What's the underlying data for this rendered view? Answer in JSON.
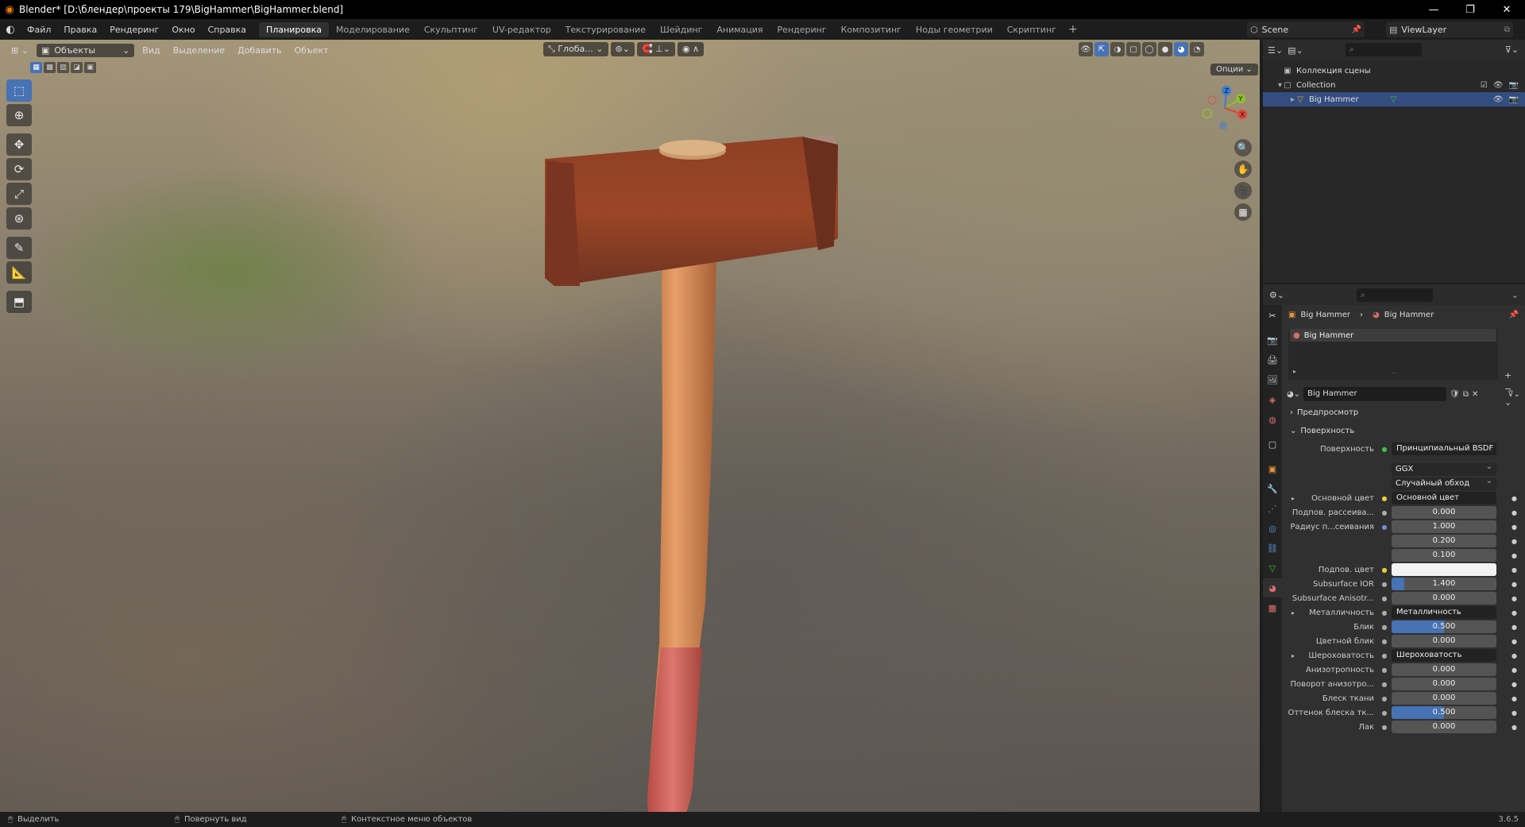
{
  "window": {
    "title": "Blender* [D:\\блендер\\проекты 179\\BigHammer\\BigHammer.blend]",
    "controls": [
      "—",
      "❐",
      "✕"
    ]
  },
  "menubar": {
    "menus": [
      "Файл",
      "Правка",
      "Рендеринг",
      "Окно",
      "Справка"
    ],
    "workspaces": [
      "Планировка",
      "Моделирование",
      "Скульптинг",
      "UV-редактор",
      "Текстурирование",
      "Шейдинг",
      "Анимация",
      "Рендеринг",
      "Композитинг",
      "Ноды геометрии",
      "Скриптинг"
    ],
    "active_workspace_index": 0,
    "add_tab": "+",
    "scene": "Scene",
    "view_layer": "ViewLayer"
  },
  "viewport": {
    "mode": "Объекты",
    "menus": [
      "Вид",
      "Выделение",
      "Добавить",
      "Объект"
    ],
    "orientation": "Глоба...",
    "options_label": "Опции"
  },
  "outliner": {
    "search_placeholder": "",
    "rows": [
      {
        "label": "Коллекция сцены"
      },
      {
        "label": "Collection"
      },
      {
        "label": "Big Hammer"
      }
    ]
  },
  "properties": {
    "breadcrumb": [
      "Big Hammer",
      "Big Hammer"
    ],
    "material_slot": "Big Hammer",
    "material_name": "Big Hammer",
    "panels": {
      "preview": "Предпросмотр",
      "surface": "Поверхность"
    },
    "surface_label": "Поверхность",
    "surface_shader": "Принципиальный BSDF",
    "distribution": "GGX",
    "subsurface_method": "Случайный обход",
    "fields": [
      {
        "label": "Основной цвет",
        "value": "Основной цвет",
        "kind": "link",
        "dot": "yel",
        "tri": true
      },
      {
        "label": "Подпов. рассеива...",
        "value": "0.000",
        "kind": "num",
        "dot": "gray",
        "fill": 0
      },
      {
        "label": "Радиус п...сеивания",
        "value": "1.000",
        "kind": "num",
        "dot": "blu",
        "fill": 0
      },
      {
        "label": "",
        "value": "0.200",
        "kind": "num",
        "dot": "",
        "fill": 0
      },
      {
        "label": "",
        "value": "0.100",
        "kind": "num",
        "dot": "",
        "fill": 0
      },
      {
        "label": "Подпов. цвет",
        "value": "",
        "kind": "white",
        "dot": "yel",
        "fill": 0
      },
      {
        "label": "Subsurface IOR",
        "value": "1.400",
        "kind": "num",
        "dot": "gray",
        "fill": 0.12
      },
      {
        "label": "Subsurface Anisotr...",
        "value": "0.000",
        "kind": "num",
        "dot": "gray",
        "fill": 0
      },
      {
        "label": "Металличность",
        "value": "Металличность",
        "kind": "link",
        "dot": "gray",
        "tri": true
      },
      {
        "label": "Блик",
        "value": "0.500",
        "kind": "num",
        "dot": "gray",
        "fill": 0.5
      },
      {
        "label": "Цветной блик",
        "value": "0.000",
        "kind": "num",
        "dot": "gray",
        "fill": 0
      },
      {
        "label": "Шероховатость",
        "value": "Шероховатость",
        "kind": "link",
        "dot": "gray",
        "tri": true
      },
      {
        "label": "Анизотропность",
        "value": "0.000",
        "kind": "num",
        "dot": "gray",
        "fill": 0
      },
      {
        "label": "Поворот анизотро...",
        "value": "0.000",
        "kind": "num",
        "dot": "gray",
        "fill": 0
      },
      {
        "label": "Блеск ткани",
        "value": "0.000",
        "kind": "num",
        "dot": "gray",
        "fill": 0
      },
      {
        "label": "Оттенок блеска тк...",
        "value": "0.500",
        "kind": "num",
        "dot": "gray",
        "fill": 0.5
      },
      {
        "label": "Лак",
        "value": "0.000",
        "kind": "num",
        "dot": "gray",
        "fill": 0
      }
    ]
  },
  "statusbar": {
    "items": [
      "Выделить",
      "Повернуть вид",
      "Контекстное меню объектов"
    ],
    "version": "3.6.5"
  },
  "colors": {
    "accent": "#4772b3",
    "selected_row": "#334d80",
    "panel_bg": "#303030"
  }
}
